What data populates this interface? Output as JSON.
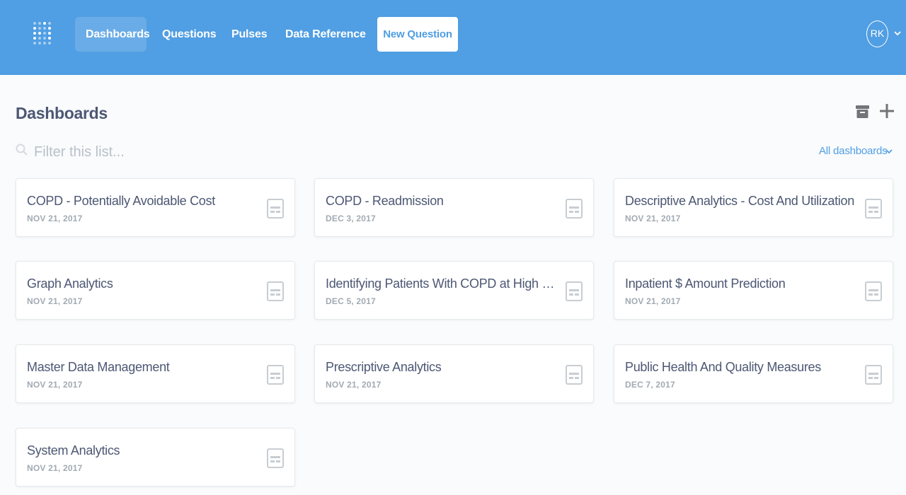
{
  "nav": {
    "items": [
      {
        "label": "Dashboards",
        "active": true
      },
      {
        "label": "Questions",
        "active": false
      },
      {
        "label": "Pulses",
        "active": false
      },
      {
        "label": "Data Reference",
        "active": false
      }
    ],
    "new_question_label": "New Question",
    "avatar_initials": "RK"
  },
  "header": {
    "title": "Dashboards"
  },
  "filter": {
    "placeholder": "Filter this list...",
    "scope_label": "All dashboards"
  },
  "dashboards": [
    {
      "title": "COPD - Potentially Avoidable Cost",
      "date": "NOV 21, 2017"
    },
    {
      "title": "COPD - Readmission",
      "date": "DEC 3, 2017"
    },
    {
      "title": "Descriptive Analytics - Cost And Utilization",
      "date": "NOV 21, 2017"
    },
    {
      "title": "Graph Analytics",
      "date": "NOV 21, 2017"
    },
    {
      "title": "Identifying Patients With COPD at High Risk ...",
      "date": "DEC 5, 2017"
    },
    {
      "title": "Inpatient $ Amount Prediction",
      "date": "NOV 21, 2017"
    },
    {
      "title": "Master Data Management",
      "date": "NOV 21, 2017"
    },
    {
      "title": "Prescriptive Analytics",
      "date": "NOV 21, 2017"
    },
    {
      "title": "Public Health And Quality Measures",
      "date": "DEC 7, 2017"
    },
    {
      "title": "System Analytics",
      "date": "NOV 21, 2017"
    }
  ],
  "colors": {
    "brand": "#509ee3",
    "text": "#4c5773",
    "muted": "#a1aab3",
    "icon": "#c8cdd2"
  },
  "icons": {
    "logo": "metabase-logo-icon",
    "search": "search-icon",
    "archive": "archive-icon",
    "add": "plus-icon",
    "dashboard": "dashboard-icon",
    "caret": "chevron-down-icon"
  }
}
